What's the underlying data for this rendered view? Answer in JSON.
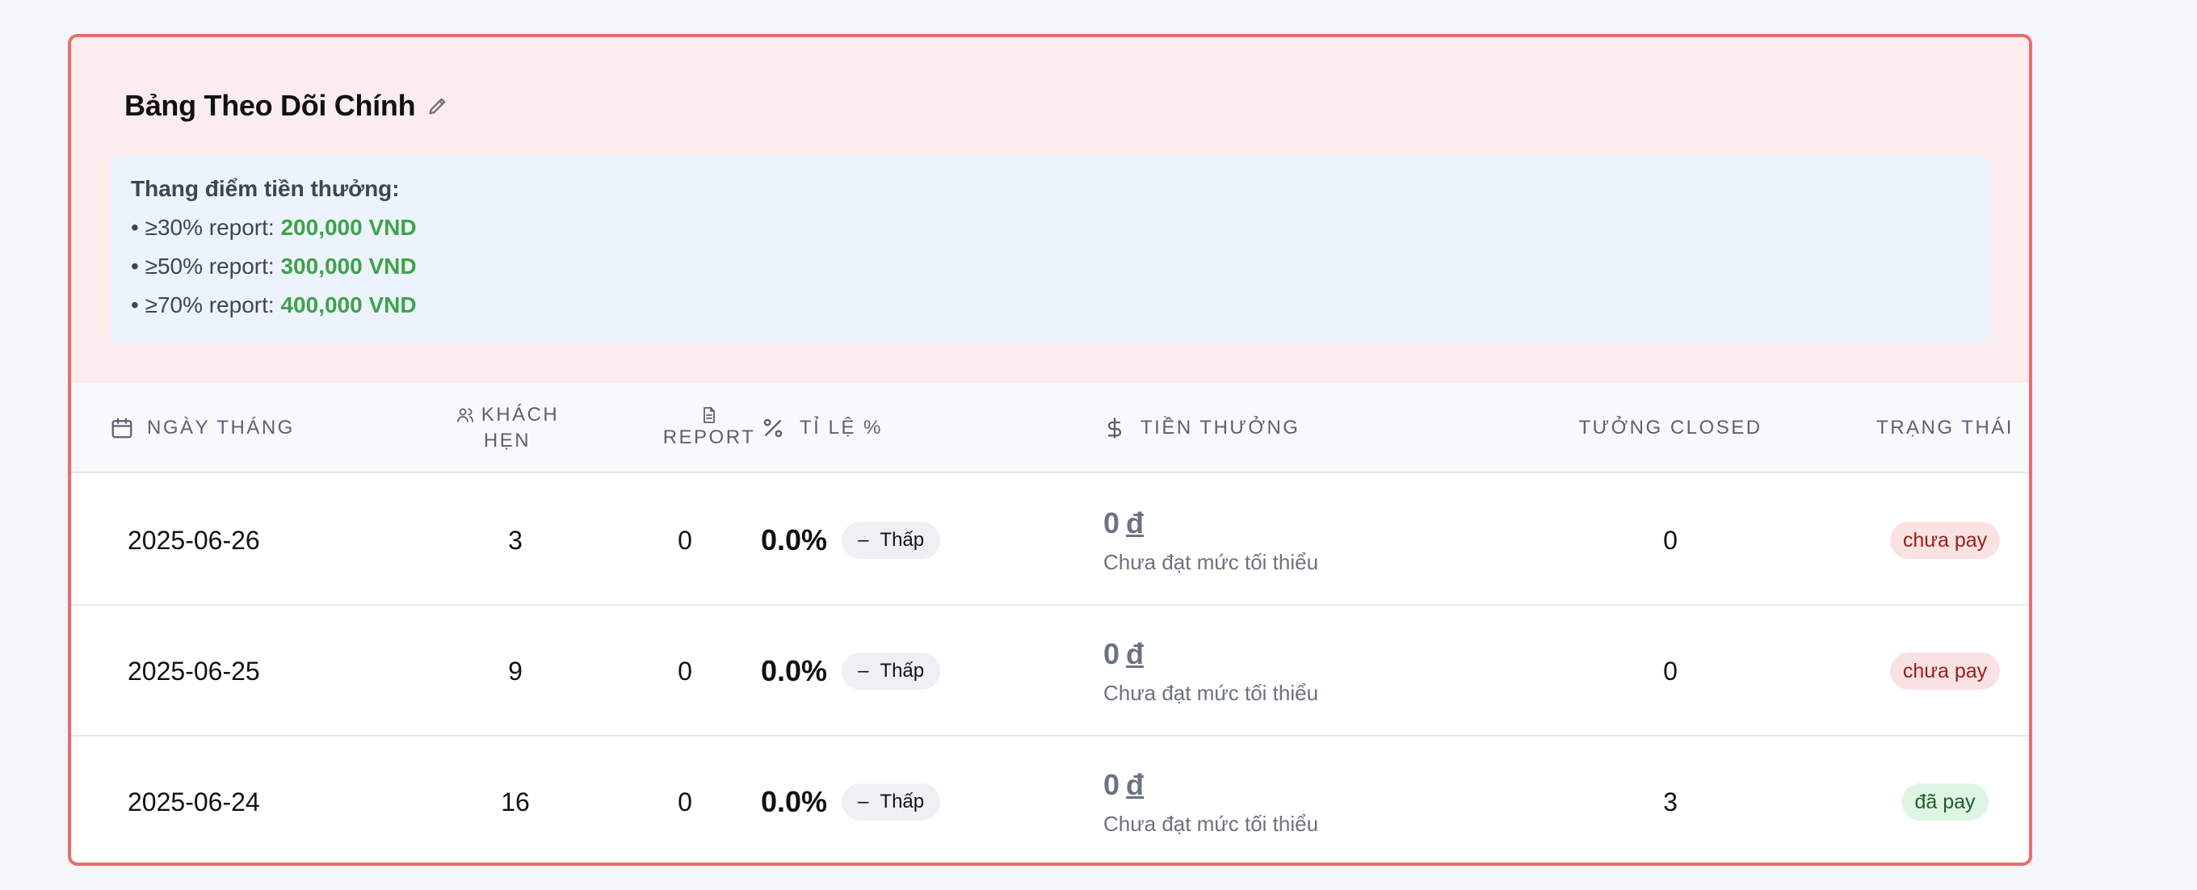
{
  "header": {
    "title": "Bảng Theo Dõi Chính",
    "edit_icon": "pencil-icon"
  },
  "bonus_scale": {
    "title": "Thang điểm tiền thưởng:",
    "tiers": [
      {
        "label": "• ≥30% report: ",
        "amount": "200,000 VND"
      },
      {
        "label": "• ≥50% report: ",
        "amount": "300,000 VND"
      },
      {
        "label": "• ≥70% report: ",
        "amount": "400,000 VND"
      }
    ],
    "amount_color": "#3ea34a"
  },
  "table": {
    "columns": {
      "date": "NGÀY THÁNG",
      "customers_line1": "KHÁCH",
      "customers_line2": "HẸN",
      "report": "REPORT",
      "rate": "TỈ LỆ %",
      "bonus": "TIỀN THƯỞNG",
      "closed": "TƯỞNG CLOSED",
      "status": "TRẠNG THÁI"
    },
    "rows": [
      {
        "date": "2025-06-26",
        "customers": "3",
        "report": "0",
        "rate": "0.0%",
        "rate_badge_icon": "–",
        "rate_badge": "Thấp",
        "bonus_amount": "0",
        "bonus_currency": "đ",
        "bonus_note": "Chưa đạt mức tối thiểu",
        "closed": "0",
        "status": "chưa pay",
        "status_kind": "unpaid"
      },
      {
        "date": "2025-06-25",
        "customers": "9",
        "report": "0",
        "rate": "0.0%",
        "rate_badge_icon": "–",
        "rate_badge": "Thấp",
        "bonus_amount": "0",
        "bonus_currency": "đ",
        "bonus_note": "Chưa đạt mức tối thiểu",
        "closed": "0",
        "status": "chưa pay",
        "status_kind": "unpaid"
      },
      {
        "date": "2025-06-24",
        "customers": "16",
        "report": "0",
        "rate": "0.0%",
        "rate_badge_icon": "–",
        "rate_badge": "Thấp",
        "bonus_amount": "0",
        "bonus_currency": "đ",
        "bonus_note": "Chưa đạt mức tối thiểu",
        "closed": "3",
        "status": "đã pay",
        "status_kind": "paid"
      }
    ]
  },
  "colors": {
    "card_border": "#ea6d6d",
    "card_header_bg": "#fbeded",
    "bonus_box_bg": "#edf3fc",
    "unpaid_bg": "#fbe2e2",
    "paid_bg": "#dff5e4"
  }
}
